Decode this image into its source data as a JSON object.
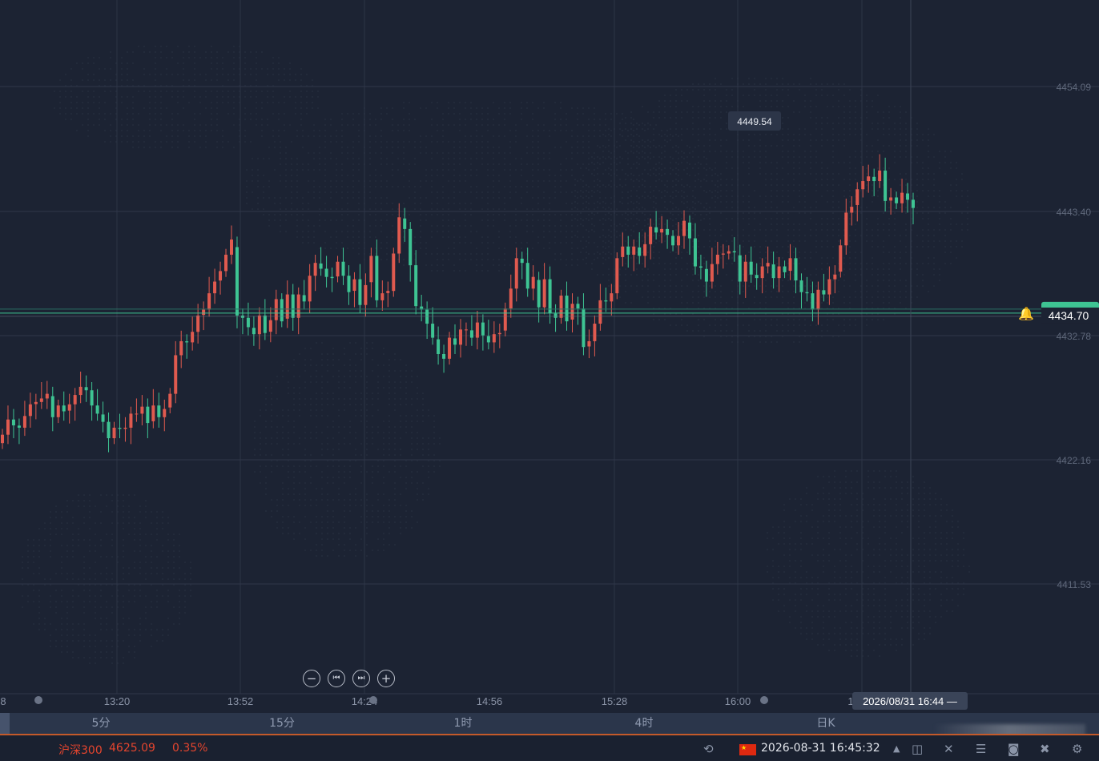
{
  "chart_data": {
    "type": "candlestick",
    "y_ticks": [
      "4454.09",
      "4443.40",
      "4432.78",
      "4422.16",
      "4411.53"
    ],
    "x_ticks": [
      "8",
      "13:20",
      "13:52",
      "14:24",
      "14:56",
      "15:28",
      "16:00",
      "1"
    ],
    "high_label": "4449.54",
    "current_price": "4434.70",
    "crosshair_time": "2026/08/31 16:44 —",
    "ylim": [
      4404.0,
      4460.0
    ],
    "candle_count": 164,
    "candle_closes": [
      4424.3,
      4425.6,
      4425.1,
      4424.9,
      4425.9,
      4426.9,
      4427.1,
      4427.4,
      4427.8,
      4425.8,
      4426.8,
      4426.3,
      4426.9,
      4427.7,
      4428.4,
      4428.1,
      4426.8,
      4426.1,
      4425.4,
      4424.0,
      4424.9,
      4424.8,
      4424.9,
      4426.1,
      4426.1,
      4426.7,
      4425.3,
      4426.8,
      4425.8,
      4426.5,
      4427.8,
      4431.1,
      4432.3,
      4432.2,
      4433.1,
      4434.5,
      4435.0,
      4436.4,
      4437.4,
      4438.3,
      4439.7,
      4441.0,
      4434.5,
      4434.3,
      4433.5,
      4432.9,
      4434.5,
      4433.0,
      4434.1,
      4435.9,
      4434.0,
      4436.3,
      4434.3,
      4436.3,
      4435.7,
      4437.9,
      4439.0,
      4438.5,
      4437.8,
      4437.7,
      4439.1,
      4437.9,
      4436.5,
      4437.6,
      4435.4,
      4437.1,
      4439.6,
      4435.8,
      4436.4,
      4436.6,
      4439.8,
      4442.9,
      4441.9,
      4438.8,
      4435.3,
      4435.0,
      4433.8,
      4432.6,
      4431.2,
      4430.8,
      4432.6,
      4432.0,
      4433.3,
      4433.3,
      4432.6,
      4433.9,
      4432.8,
      4432.2,
      4432.9,
      4433.0,
      4435.1,
      4436.8,
      4439.4,
      4439.0,
      4436.8,
      4437.8,
      4435.2,
      4437.6,
      4434.7,
      4434.3,
      4436.2,
      4434.0,
      4435.5,
      4435.1,
      4431.8,
      4432.3,
      4433.8,
      4435.8,
      4435.7,
      4436.4,
      4439.4,
      4440.4,
      4439.7,
      4440.4,
      4439.6,
      4440.6,
      4442.1,
      4441.6,
      4441.9,
      4441.4,
      4440.5,
      4441.3,
      4442.6,
      4441.1,
      4438.7,
      4438.6,
      4437.4,
      4438.9,
      4439.7,
      4439.8,
      4440.0,
      4439.9,
      4437.4,
      4439.1,
      4438.0,
      4437.7,
      4438.7,
      4439.0,
      4437.7,
      4438.7,
      4438.2,
      4439.4,
      4437.5,
      4436.5,
      4436.4,
      4435.0,
      4436.7,
      4436.3,
      4437.6,
      4438.0,
      4440.5,
      4443.3,
      4443.8,
      4445.3,
      4446.0,
      4446.4,
      4446.0,
      4446.9,
      4444.3,
      4444.6,
      4444.1,
      4445.0,
      4444.4,
      4443.7
    ],
    "note_ignore": ""
  },
  "period_tabs": [
    "5分",
    "15分",
    "1时",
    "4时",
    "日K"
  ],
  "status": {
    "index_name": "沪深300",
    "index_value": "4625.09",
    "index_change": "0.35%",
    "flag_icon": "china-flag",
    "datetime": "2026-08-31 16:45:32"
  },
  "zoom": {
    "minus": "−",
    "start": "⏮",
    "end": "⏭",
    "plus": "+"
  },
  "colors": {
    "background": "#1c2333",
    "up": "#e05a4f",
    "down": "#3ec493",
    "price_line": "#3ec493",
    "index_text": "#e5452e"
  }
}
